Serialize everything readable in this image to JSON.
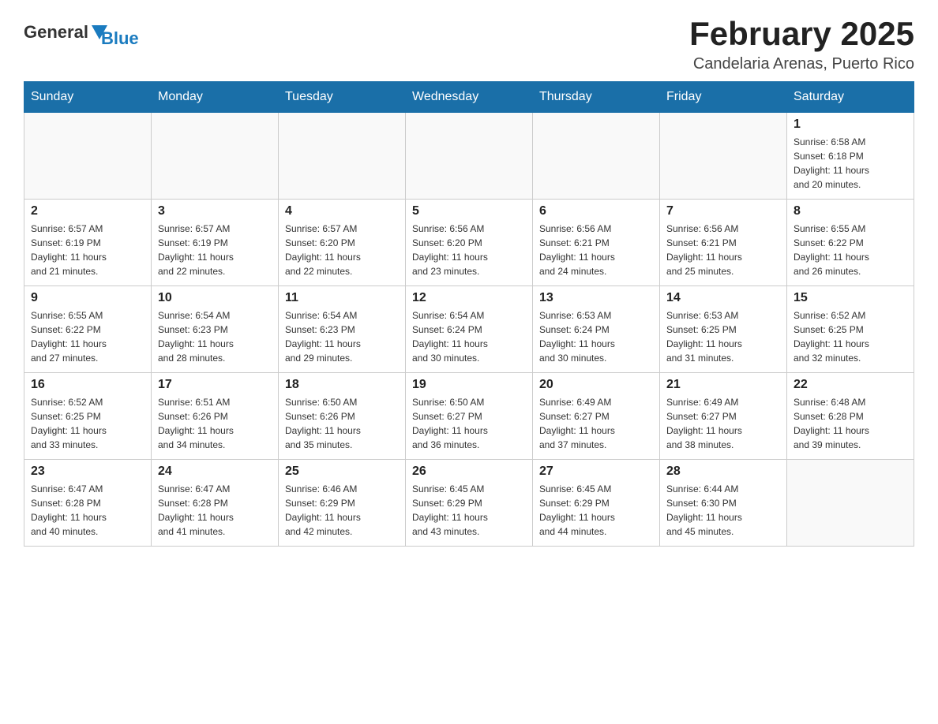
{
  "logo": {
    "general": "General",
    "blue": "Blue"
  },
  "title": "February 2025",
  "subtitle": "Candelaria Arenas, Puerto Rico",
  "days_of_week": [
    "Sunday",
    "Monday",
    "Tuesday",
    "Wednesday",
    "Thursday",
    "Friday",
    "Saturday"
  ],
  "weeks": [
    [
      {
        "day": "",
        "info": ""
      },
      {
        "day": "",
        "info": ""
      },
      {
        "day": "",
        "info": ""
      },
      {
        "day": "",
        "info": ""
      },
      {
        "day": "",
        "info": ""
      },
      {
        "day": "",
        "info": ""
      },
      {
        "day": "1",
        "info": "Sunrise: 6:58 AM\nSunset: 6:18 PM\nDaylight: 11 hours\nand 20 minutes."
      }
    ],
    [
      {
        "day": "2",
        "info": "Sunrise: 6:57 AM\nSunset: 6:19 PM\nDaylight: 11 hours\nand 21 minutes."
      },
      {
        "day": "3",
        "info": "Sunrise: 6:57 AM\nSunset: 6:19 PM\nDaylight: 11 hours\nand 22 minutes."
      },
      {
        "day": "4",
        "info": "Sunrise: 6:57 AM\nSunset: 6:20 PM\nDaylight: 11 hours\nand 22 minutes."
      },
      {
        "day": "5",
        "info": "Sunrise: 6:56 AM\nSunset: 6:20 PM\nDaylight: 11 hours\nand 23 minutes."
      },
      {
        "day": "6",
        "info": "Sunrise: 6:56 AM\nSunset: 6:21 PM\nDaylight: 11 hours\nand 24 minutes."
      },
      {
        "day": "7",
        "info": "Sunrise: 6:56 AM\nSunset: 6:21 PM\nDaylight: 11 hours\nand 25 minutes."
      },
      {
        "day": "8",
        "info": "Sunrise: 6:55 AM\nSunset: 6:22 PM\nDaylight: 11 hours\nand 26 minutes."
      }
    ],
    [
      {
        "day": "9",
        "info": "Sunrise: 6:55 AM\nSunset: 6:22 PM\nDaylight: 11 hours\nand 27 minutes."
      },
      {
        "day": "10",
        "info": "Sunrise: 6:54 AM\nSunset: 6:23 PM\nDaylight: 11 hours\nand 28 minutes."
      },
      {
        "day": "11",
        "info": "Sunrise: 6:54 AM\nSunset: 6:23 PM\nDaylight: 11 hours\nand 29 minutes."
      },
      {
        "day": "12",
        "info": "Sunrise: 6:54 AM\nSunset: 6:24 PM\nDaylight: 11 hours\nand 30 minutes."
      },
      {
        "day": "13",
        "info": "Sunrise: 6:53 AM\nSunset: 6:24 PM\nDaylight: 11 hours\nand 30 minutes."
      },
      {
        "day": "14",
        "info": "Sunrise: 6:53 AM\nSunset: 6:25 PM\nDaylight: 11 hours\nand 31 minutes."
      },
      {
        "day": "15",
        "info": "Sunrise: 6:52 AM\nSunset: 6:25 PM\nDaylight: 11 hours\nand 32 minutes."
      }
    ],
    [
      {
        "day": "16",
        "info": "Sunrise: 6:52 AM\nSunset: 6:25 PM\nDaylight: 11 hours\nand 33 minutes."
      },
      {
        "day": "17",
        "info": "Sunrise: 6:51 AM\nSunset: 6:26 PM\nDaylight: 11 hours\nand 34 minutes."
      },
      {
        "day": "18",
        "info": "Sunrise: 6:50 AM\nSunset: 6:26 PM\nDaylight: 11 hours\nand 35 minutes."
      },
      {
        "day": "19",
        "info": "Sunrise: 6:50 AM\nSunset: 6:27 PM\nDaylight: 11 hours\nand 36 minutes."
      },
      {
        "day": "20",
        "info": "Sunrise: 6:49 AM\nSunset: 6:27 PM\nDaylight: 11 hours\nand 37 minutes."
      },
      {
        "day": "21",
        "info": "Sunrise: 6:49 AM\nSunset: 6:27 PM\nDaylight: 11 hours\nand 38 minutes."
      },
      {
        "day": "22",
        "info": "Sunrise: 6:48 AM\nSunset: 6:28 PM\nDaylight: 11 hours\nand 39 minutes."
      }
    ],
    [
      {
        "day": "23",
        "info": "Sunrise: 6:47 AM\nSunset: 6:28 PM\nDaylight: 11 hours\nand 40 minutes."
      },
      {
        "day": "24",
        "info": "Sunrise: 6:47 AM\nSunset: 6:28 PM\nDaylight: 11 hours\nand 41 minutes."
      },
      {
        "day": "25",
        "info": "Sunrise: 6:46 AM\nSunset: 6:29 PM\nDaylight: 11 hours\nand 42 minutes."
      },
      {
        "day": "26",
        "info": "Sunrise: 6:45 AM\nSunset: 6:29 PM\nDaylight: 11 hours\nand 43 minutes."
      },
      {
        "day": "27",
        "info": "Sunrise: 6:45 AM\nSunset: 6:29 PM\nDaylight: 11 hours\nand 44 minutes."
      },
      {
        "day": "28",
        "info": "Sunrise: 6:44 AM\nSunset: 6:30 PM\nDaylight: 11 hours\nand 45 minutes."
      },
      {
        "day": "",
        "info": ""
      }
    ]
  ]
}
